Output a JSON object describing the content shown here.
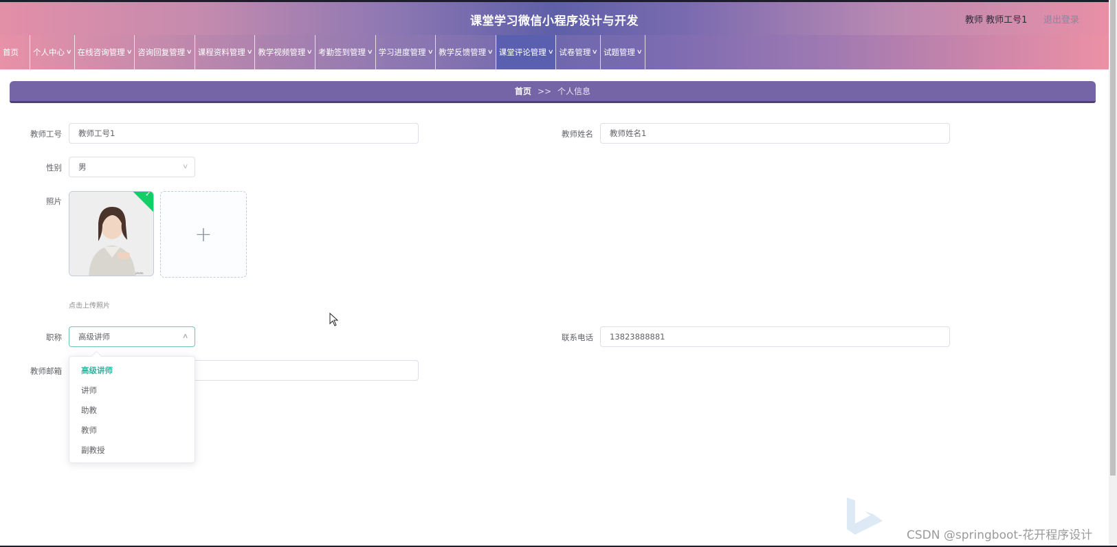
{
  "header": {
    "title": "课堂学习微信小程序设计与开发",
    "user": "教师 教师工号1",
    "logout": "退出登录"
  },
  "nav": [
    {
      "label": "首页",
      "has_arrow": false
    },
    {
      "label": "个人中心",
      "has_arrow": true
    },
    {
      "label": "在线咨询管理",
      "has_arrow": true
    },
    {
      "label": "咨询回复管理",
      "has_arrow": true
    },
    {
      "label": "课程资料管理",
      "has_arrow": true
    },
    {
      "label": "教学视频管理",
      "has_arrow": true
    },
    {
      "label": "考勤签到管理",
      "has_arrow": true
    },
    {
      "label": "学习进度管理",
      "has_arrow": true
    },
    {
      "label": "教学反馈管理",
      "has_arrow": true
    },
    {
      "label": "课堂评论管理",
      "has_arrow": true,
      "active": true
    },
    {
      "label": "试卷管理",
      "has_arrow": true
    },
    {
      "label": "试题管理",
      "has_arrow": true
    }
  ],
  "breadcrumb": {
    "home": "首页",
    "separator": ">>",
    "current": "个人信息"
  },
  "form": {
    "teacher_id": {
      "label": "教师工号",
      "value": "教师工号1"
    },
    "teacher_name": {
      "label": "教师姓名",
      "value": "教师姓名1"
    },
    "gender": {
      "label": "性别",
      "value": "男"
    },
    "photo": {
      "label": "照片",
      "tip": "点击上传照片",
      "upload_plus": "+"
    },
    "title": {
      "label": "职称",
      "value": "高级讲师"
    },
    "phone": {
      "label": "联系电话",
      "value": "13823888881"
    },
    "email": {
      "label": "教师邮箱",
      "value": ""
    }
  },
  "title_options": [
    "高级讲师",
    "讲师",
    "助教",
    "教师",
    "副教授"
  ],
  "watermark": "CSDN @springboot-花开程序设计",
  "colors": {
    "accent": "#2fb6a1",
    "breadcrumb": "#7665a6",
    "active_nav": "#5b5fb0"
  }
}
